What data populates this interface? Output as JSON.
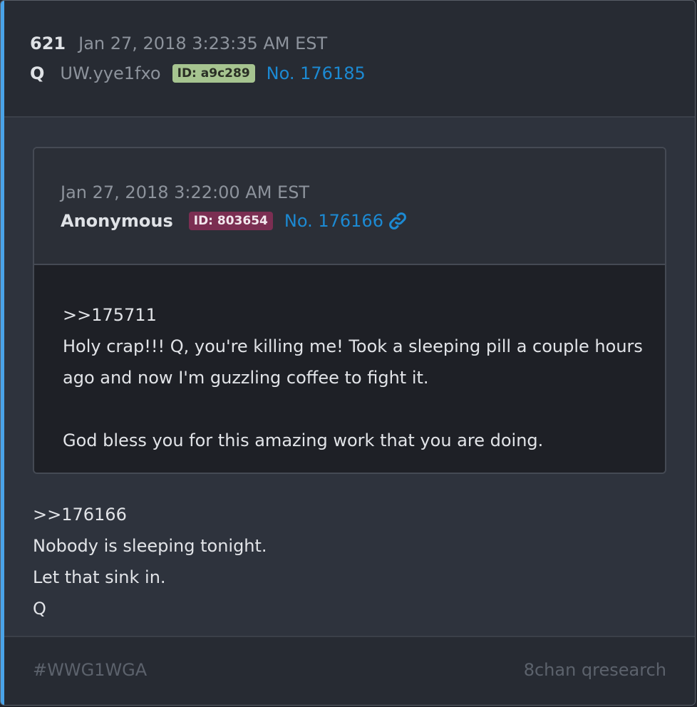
{
  "post": {
    "number": "621",
    "timestamp": "Jan 27, 2018 3:23:35 AM EST",
    "author": "Q",
    "tripcode": "UW.yye1fxo",
    "id_badge": "ID: a9c289",
    "post_link": "No. 176185"
  },
  "quoted_post": {
    "timestamp": "Jan 27, 2018 3:22:00 AM EST",
    "author": "Anonymous",
    "id_badge": "ID: 803654",
    "post_link": "No. 176166",
    "link_icon": "link-icon",
    "lines": [
      ">>175711",
      "Holy crap!!! Q, you're killing me! Took a sleeping pill a couple hours ago and now I'm guzzling coffee to fight it.",
      "",
      "God bless you for this amazing work that you are doing."
    ]
  },
  "body": {
    "lines": [
      ">>176166",
      "Nobody is sleeping tonight.",
      "Let that sink in.",
      "Q"
    ]
  },
  "footer": {
    "hashtag": "#WWG1WGA",
    "source": "8chan qresearch"
  },
  "colors": {
    "accent_bar": "#4aa3e8",
    "link": "#1c8ad3",
    "id_green": "#a6c490",
    "id_maroon": "#7b2e52"
  }
}
